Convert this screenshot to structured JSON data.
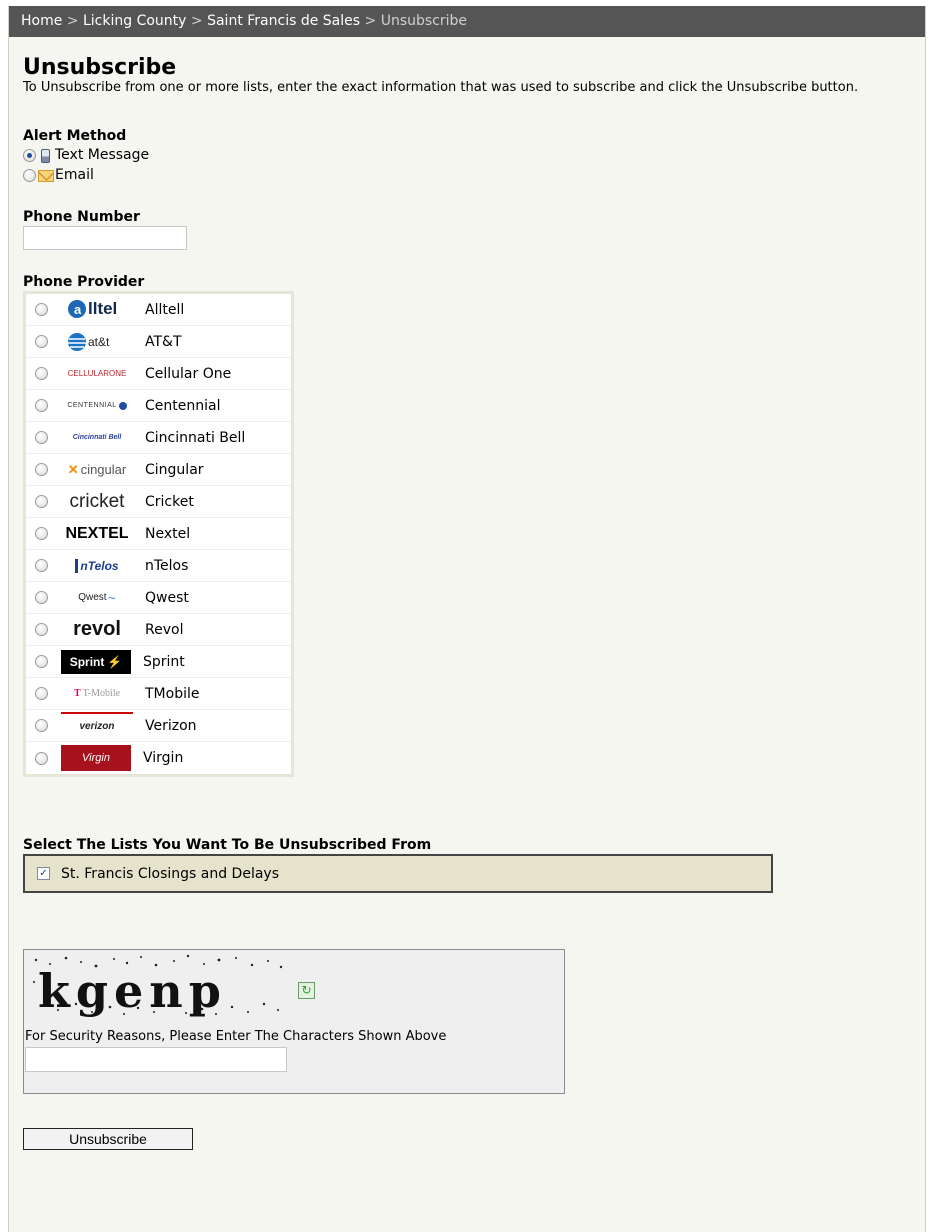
{
  "breadcrumb": {
    "home": "Home",
    "county": "Licking County",
    "school": "Saint Francis de Sales",
    "current": "Unsubscribe",
    "separator": ">"
  },
  "page": {
    "title": "Unsubscribe",
    "intro": "To Unsubscribe from one or more lists, enter the exact information that was used to subscribe and click the Unsubscribe button."
  },
  "alert_method": {
    "label": "Alert Method",
    "options": [
      {
        "label": "Text Message",
        "checked": true,
        "icon": "phone-icon"
      },
      {
        "label": "Email",
        "checked": false,
        "icon": "mail-icon"
      }
    ]
  },
  "phone": {
    "label": "Phone Number",
    "value": ""
  },
  "provider": {
    "label": "Phone Provider",
    "options": [
      {
        "name": "Alltell",
        "logo": "alltel"
      },
      {
        "name": "AT&T",
        "logo": "at&t"
      },
      {
        "name": "Cellular One",
        "logo": "CELLULARONE"
      },
      {
        "name": "Centennial",
        "logo": "CENTENNIAL"
      },
      {
        "name": "Cincinnati Bell",
        "logo": "Cincinnati Bell"
      },
      {
        "name": "Cingular",
        "logo": "cingular"
      },
      {
        "name": "Cricket",
        "logo": "cricket"
      },
      {
        "name": "Nextel",
        "logo": "NEXTEL"
      },
      {
        "name": "nTelos",
        "logo": "nTelos"
      },
      {
        "name": "Qwest",
        "logo": "Qwest"
      },
      {
        "name": "Revol",
        "logo": "revol"
      },
      {
        "name": "Sprint",
        "logo": "Sprint"
      },
      {
        "name": "TMobile",
        "logo": "T-Mobile"
      },
      {
        "name": "Verizon",
        "logo": "verizon"
      },
      {
        "name": "Virgin",
        "logo": "Virgin"
      }
    ]
  },
  "lists": {
    "label": "Select The Lists You Want To Be Unsubscribed From",
    "items": [
      {
        "label": "St. Francis Closings and Delays",
        "checked": true
      }
    ]
  },
  "captcha": {
    "word": "kgenp",
    "instruction": "For Security Reasons, Please Enter The Characters Shown Above",
    "value": ""
  },
  "submit": {
    "label": "Unsubscribe"
  }
}
